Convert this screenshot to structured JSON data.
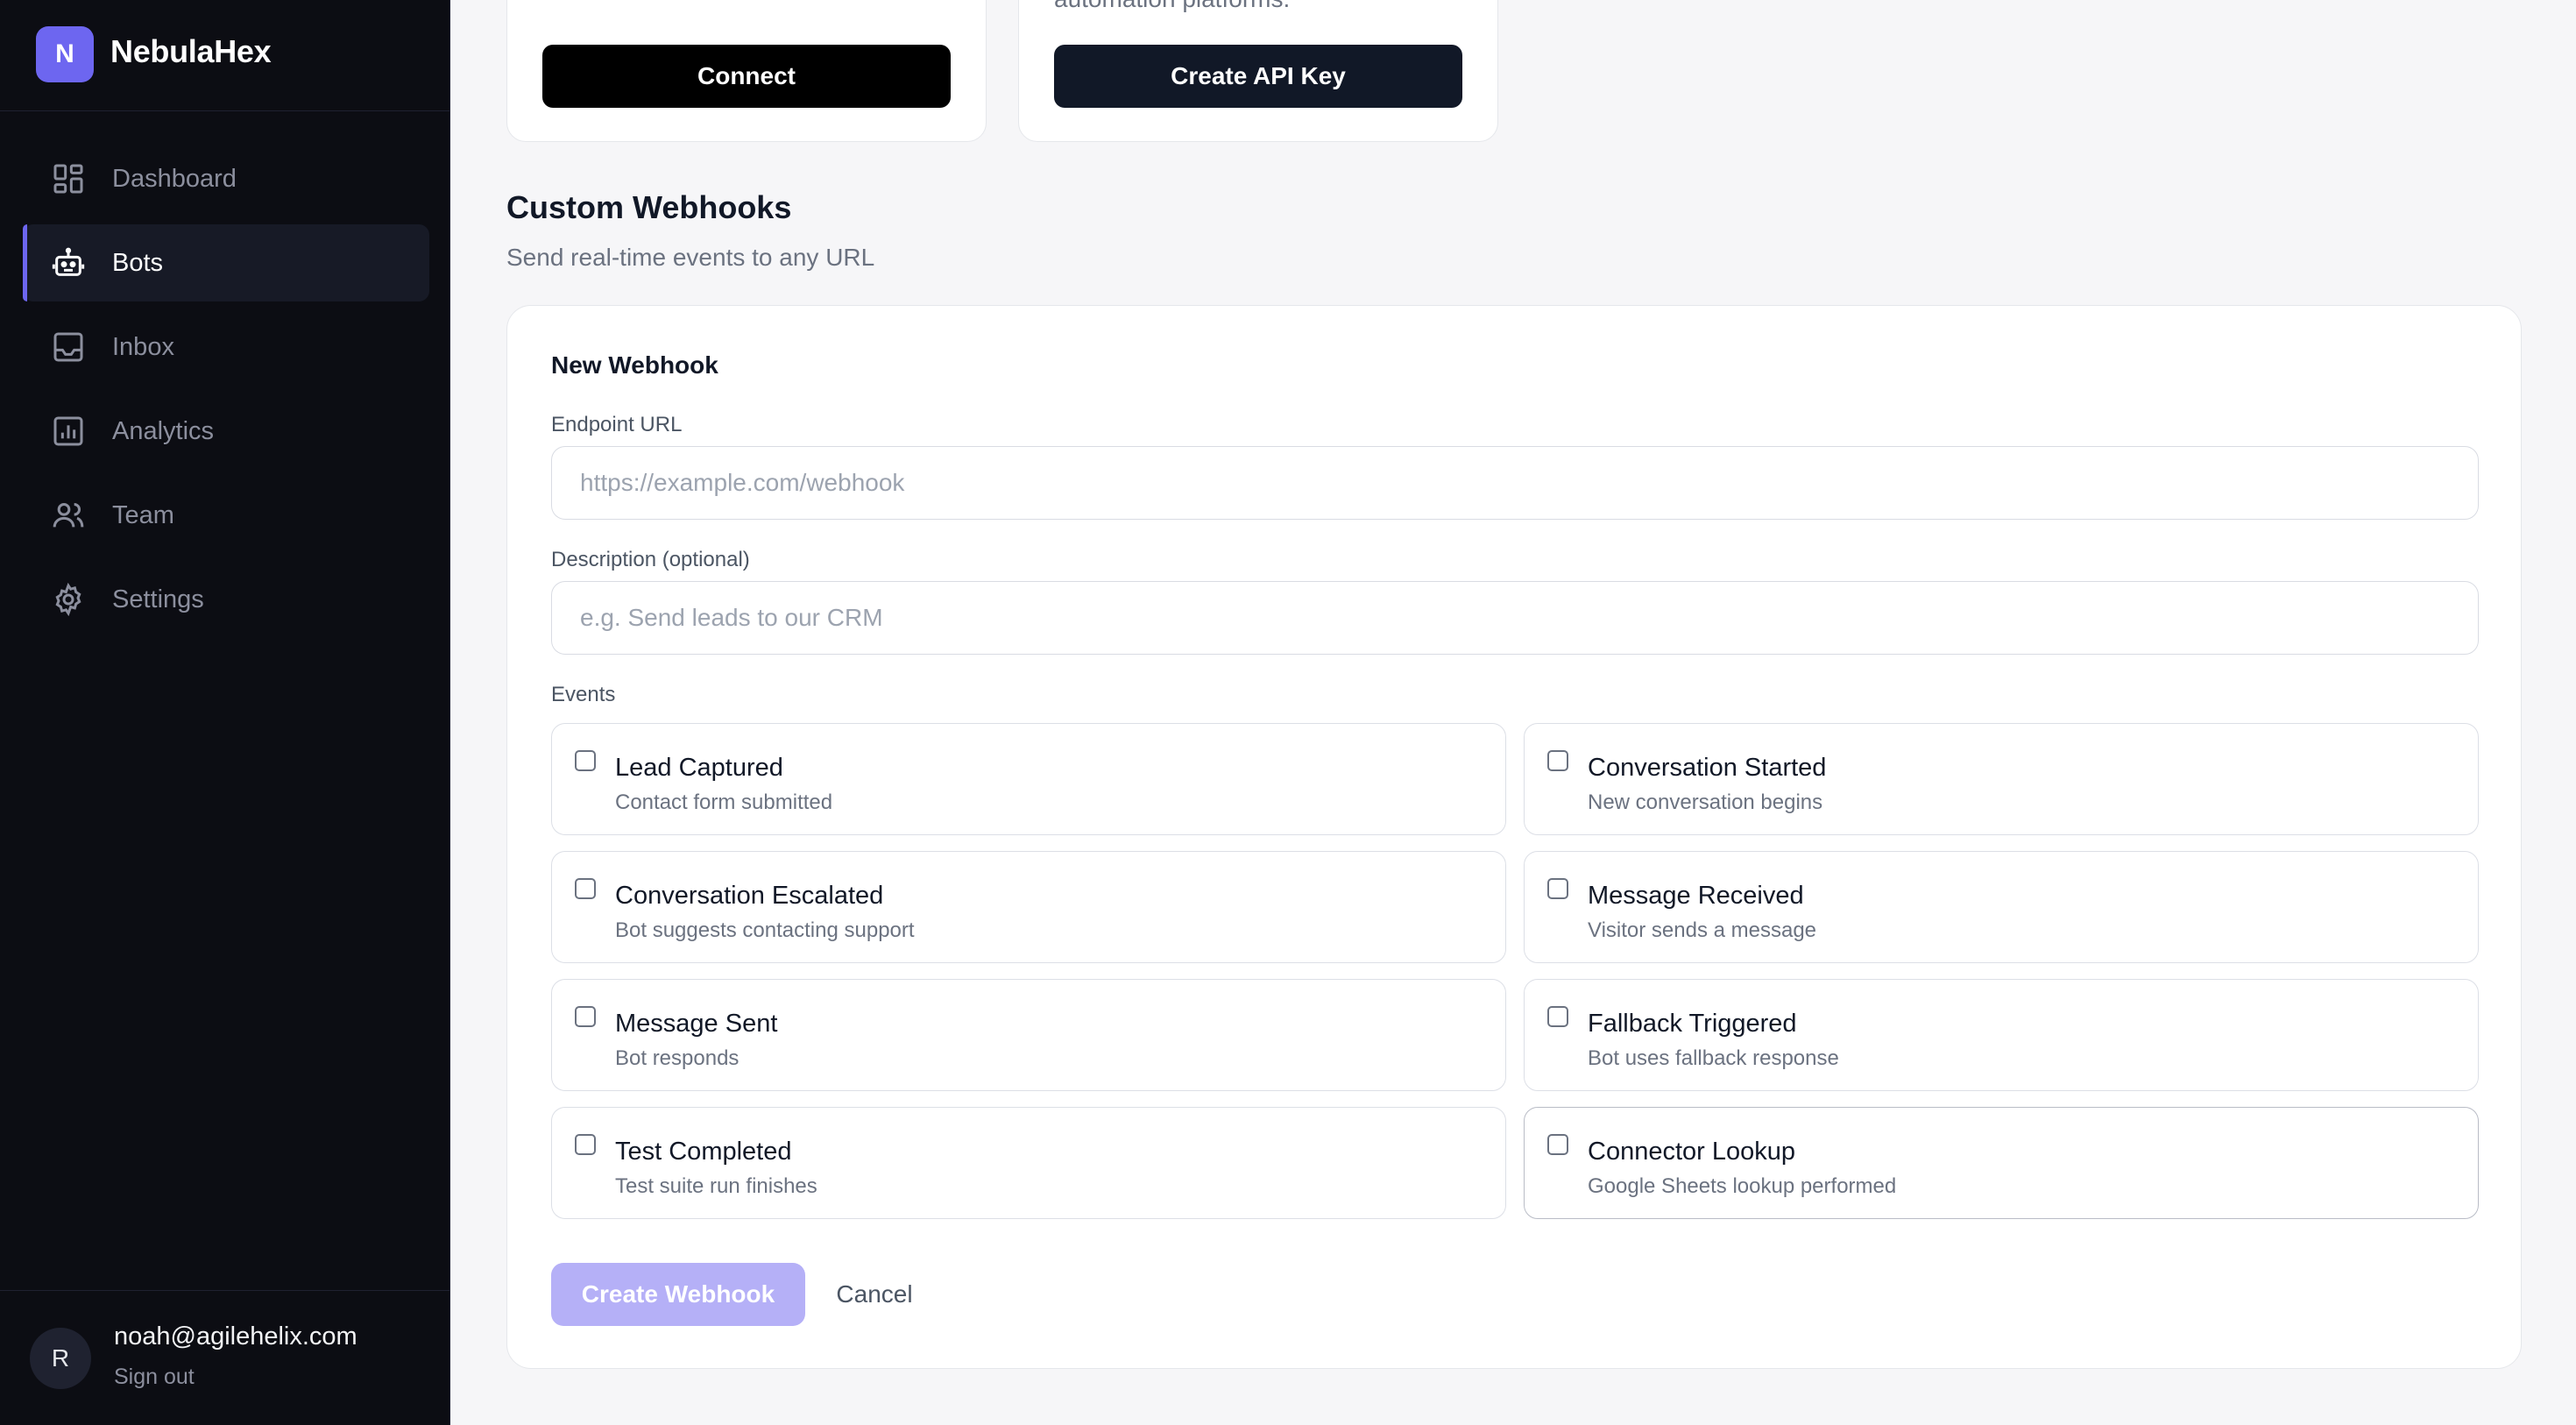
{
  "brand": {
    "logo_letter": "N",
    "name": "NebulaHex",
    "accent": "#6d66f0"
  },
  "sidebar": {
    "items": [
      {
        "label": "Dashboard",
        "icon": "dashboard-icon"
      },
      {
        "label": "Bots",
        "icon": "bot-icon",
        "active": true
      },
      {
        "label": "Inbox",
        "icon": "inbox-icon"
      },
      {
        "label": "Analytics",
        "icon": "analytics-icon"
      },
      {
        "label": "Team",
        "icon": "team-icon"
      },
      {
        "label": "Settings",
        "icon": "gear-icon"
      }
    ]
  },
  "user": {
    "avatar_letter": "R",
    "email": "noah@agilehelix.com",
    "sign_out": "Sign out"
  },
  "top_cards": [
    {
      "desc_tail": "",
      "button": "Connect"
    },
    {
      "desc_tail": "automation platforms.",
      "button": "Create API Key"
    }
  ],
  "webhooks": {
    "title": "Custom Webhooks",
    "subtitle": "Send real-time events to any URL",
    "form": {
      "title": "New Webhook",
      "endpoint_label": "Endpoint URL",
      "endpoint_placeholder": "https://example.com/webhook",
      "endpoint_value": "",
      "description_label": "Description (optional)",
      "description_placeholder": "e.g. Send leads to our CRM",
      "description_value": "",
      "events_label": "Events",
      "events": [
        {
          "title": "Lead Captured",
          "desc": "Contact form submitted",
          "checked": false
        },
        {
          "title": "Conversation Started",
          "desc": "New conversation begins",
          "checked": false
        },
        {
          "title": "Conversation Escalated",
          "desc": "Bot suggests contacting support",
          "checked": false
        },
        {
          "title": "Message Received",
          "desc": "Visitor sends a message",
          "checked": false
        },
        {
          "title": "Message Sent",
          "desc": "Bot responds",
          "checked": false
        },
        {
          "title": "Fallback Triggered",
          "desc": "Bot uses fallback response",
          "checked": false
        },
        {
          "title": "Test Completed",
          "desc": "Test suite run finishes",
          "checked": false
        },
        {
          "title": "Connector Lookup",
          "desc": "Google Sheets lookup performed",
          "checked": false
        }
      ],
      "create_button": "Create Webhook",
      "cancel_button": "Cancel"
    }
  }
}
